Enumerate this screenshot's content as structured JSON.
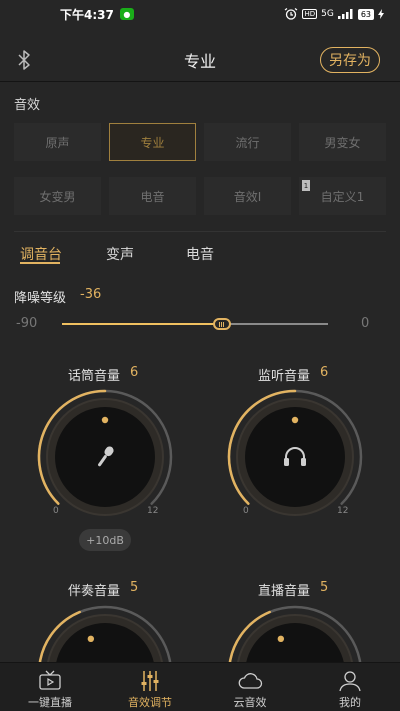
{
  "status_bar": {
    "time": "下午4:37",
    "network": "5G",
    "battery": "63"
  },
  "header": {
    "title": "专业",
    "save_as": "另存为"
  },
  "effects": {
    "title": "音效",
    "presets": [
      {
        "label": "原声",
        "active": false
      },
      {
        "label": "专业",
        "active": true
      },
      {
        "label": "流行",
        "active": false
      },
      {
        "label": "男变女",
        "active": false
      },
      {
        "label": "女变男",
        "active": false
      },
      {
        "label": "电音",
        "active": false
      },
      {
        "label": "音效I",
        "active": false
      },
      {
        "label": "自定义1",
        "active": false,
        "tag": "1"
      }
    ]
  },
  "tabs": [
    {
      "label": "调音台",
      "active": true
    },
    {
      "label": "变声",
      "active": false
    },
    {
      "label": "电音",
      "active": false
    }
  ],
  "noise": {
    "label": "降噪等级",
    "value": "-36",
    "min": "-90",
    "max": "0",
    "numeric_value": -36,
    "numeric_min": -90,
    "numeric_max": 0
  },
  "knobs": [
    {
      "label": "话筒音量",
      "value": "6",
      "numeric": 6,
      "min": "0",
      "max": "12",
      "icon": "microphone-icon"
    },
    {
      "label": "监听音量",
      "value": "6",
      "numeric": 6,
      "min": "0",
      "max": "12",
      "icon": "headphones-icon"
    },
    {
      "label": "伴奏音量",
      "value": "5",
      "numeric": 5,
      "min": "0",
      "max": "12",
      "icon": "none"
    },
    {
      "label": "直播音量",
      "value": "5",
      "numeric": 5,
      "min": "0",
      "max": "12",
      "icon": "none"
    }
  ],
  "gain_button": "+10dB",
  "bottom_nav": [
    {
      "label": "一键直播",
      "icon": "tv-play-icon",
      "active": false
    },
    {
      "label": "音效调节",
      "icon": "equalizer-icon",
      "active": true
    },
    {
      "label": "云音效",
      "icon": "cloud-icon",
      "active": false
    },
    {
      "label": "我的",
      "icon": "user-icon",
      "active": false
    }
  ],
  "colors": {
    "accent": "#e2b361",
    "background": "#262626",
    "knob_inactive": "#5a5a5a"
  }
}
